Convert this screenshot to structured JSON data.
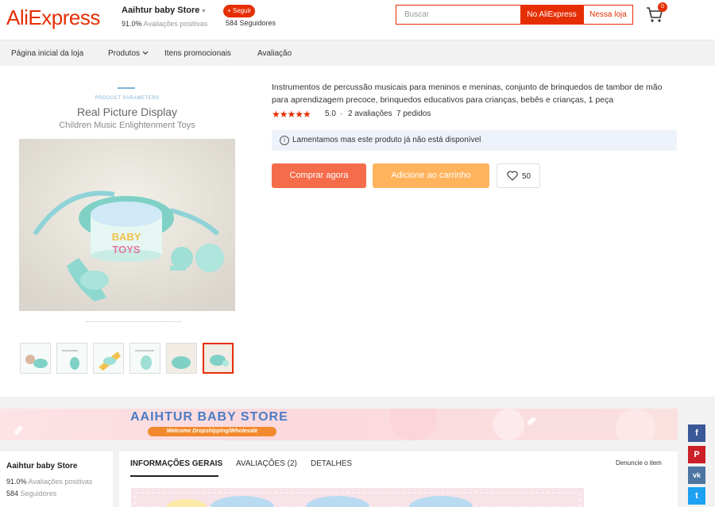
{
  "header": {
    "logo": "AliExpress",
    "store_name": "Aaihtur baby Store",
    "store_caret": "▾",
    "positive_pct": "91.0%",
    "positive_label": "Avaliações positivas",
    "follow_label": "+ Seguir",
    "followers": "584 Seguidores",
    "search_placeholder": "Buscar",
    "search_ali_label": "No AliExpress",
    "search_store_label": "Nessa loja",
    "cart_count": "0"
  },
  "nav": {
    "items": [
      "Página inicial da loja",
      "Produtos",
      "Itens promocionais",
      "Avaliação"
    ]
  },
  "product": {
    "image": {
      "label": "PRODUCT PARAMETERS",
      "title": "Real Picture Display",
      "subtitle": "Children Music Enlightenment Toys",
      "toy_text_1": "BABY",
      "toy_text_2": "TOYS"
    },
    "title": "Instrumentos de percussão musicais para meninos e meninas, conjunto de brinquedos de tambor de mão para aprendizagem precoce, brinquedos educativos para crianças, bebês e crianças, 1 peça",
    "stars": "★★★★★",
    "rating": "5.0",
    "separator": "·",
    "reviews": "2 avaliações",
    "orders": "7 pedidos",
    "notice_icon": "i",
    "notice": "Lamentamos mas este produto já não está disponível",
    "buy_now_label": "Comprar agora",
    "add_cart_label": "Adicione ao carrinho",
    "wishlist_count": "50"
  },
  "banner": {
    "title": "AAIHTUR BABY STORE",
    "subtitle": "Welcome Dropshipping/Wholesale"
  },
  "sidebar": {
    "store_name": "Aaihtur baby Store",
    "positive_pct": "91.0%",
    "positive_label": "Avaliações positivas",
    "followers_count": "584",
    "followers_label": "Seguidores"
  },
  "tabs": {
    "items": [
      "INFORMAÇÕES GERAIS",
      "AVALIAÇÕES (2)",
      "DETALHES"
    ],
    "report_label": "Denuncie o item"
  },
  "social": [
    "f",
    "P",
    "vk",
    "t"
  ],
  "colors": {
    "brand": "#e62e04",
    "buy": "#f4532b",
    "cart": "#ffa640",
    "facebook": "#3b5998",
    "pinterest": "#cb2027",
    "vk": "#4c75a3",
    "twitter": "#1da1f2"
  }
}
